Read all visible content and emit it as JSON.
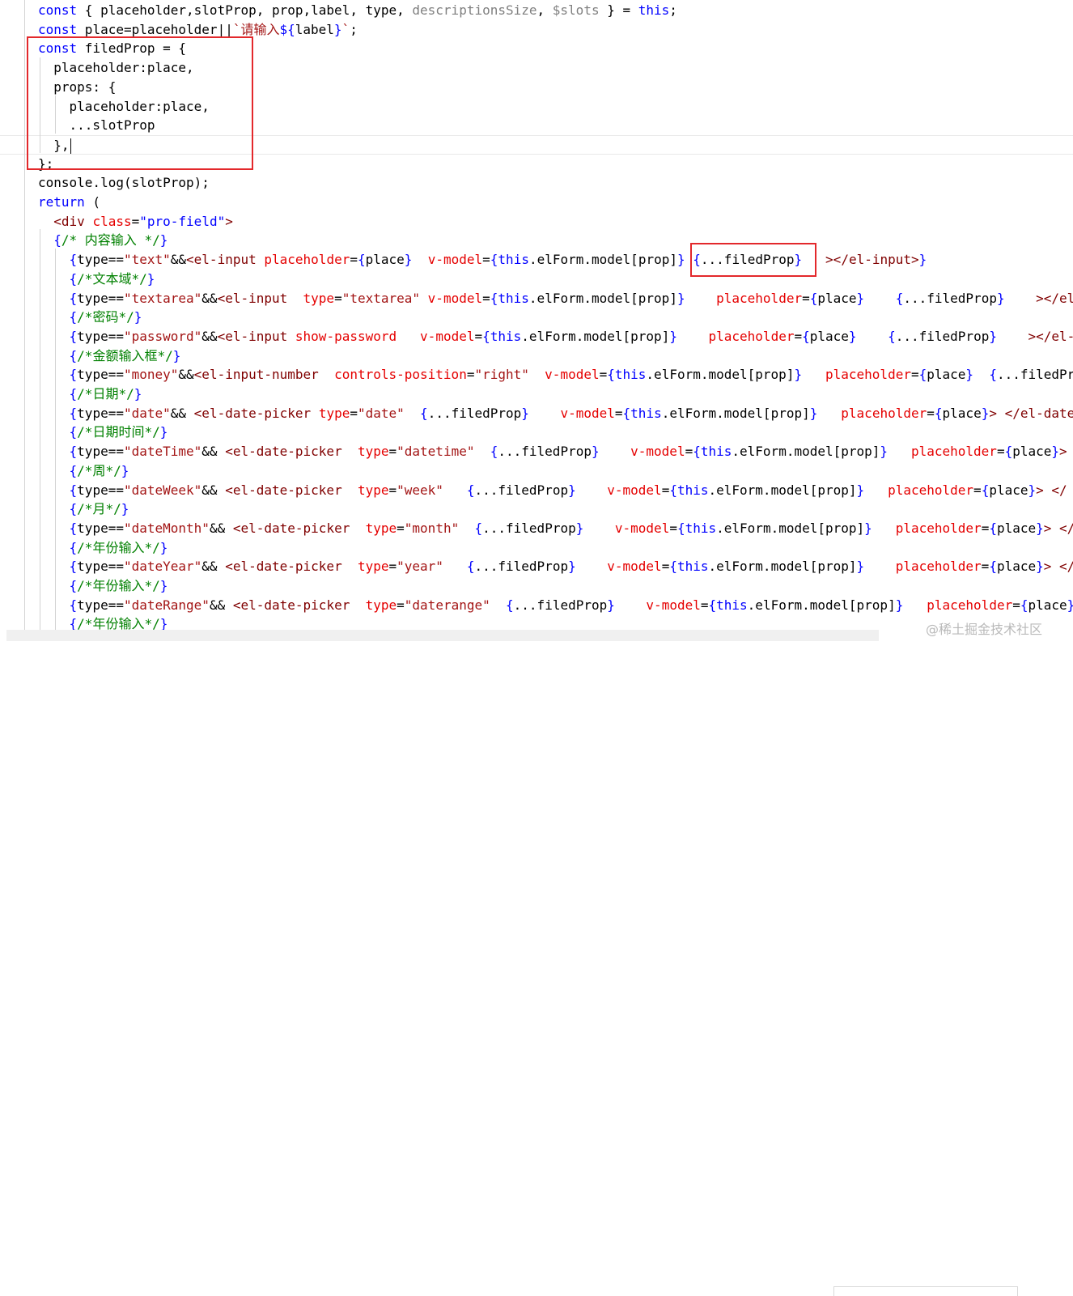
{
  "colors": {
    "keyword": "#0000ff",
    "string": "#a31515",
    "attribute": "#e50000",
    "tag": "#800000",
    "comment": "#008000",
    "muted": "#7f7f7f",
    "plain": "#000000",
    "highlight_box": "#e3282b"
  },
  "code_lines": [
    [
      [
        "const",
        "keyword"
      ],
      [
        " { placeholder,slotProp, prop,label, type, ",
        "plain"
      ],
      [
        "descriptionsSize",
        "muted"
      ],
      [
        ", ",
        "plain"
      ],
      [
        "$slots",
        "muted"
      ],
      [
        " } = ",
        "plain"
      ],
      [
        "this",
        "keyword"
      ],
      [
        ";",
        "plain"
      ]
    ],
    [
      [
        "const",
        "keyword"
      ],
      [
        " place=placeholder||",
        "plain"
      ],
      [
        "`请输入",
        "string"
      ],
      [
        "${",
        "keyword"
      ],
      [
        "label",
        "plain"
      ],
      [
        "}",
        "keyword"
      ],
      [
        "`",
        "string"
      ],
      [
        ";",
        "plain"
      ]
    ],
    [
      [
        "const",
        "keyword"
      ],
      [
        " filedProp = {",
        "plain"
      ]
    ],
    [
      [
        "  placeholder:place,",
        "plain"
      ]
    ],
    [
      [
        "  props: {",
        "plain"
      ]
    ],
    [
      [
        "    placeholder:place,",
        "plain"
      ]
    ],
    [
      [
        "    ...slotProp",
        "plain"
      ]
    ],
    [
      [
        "  },",
        "plain"
      ]
    ],
    [
      [
        "};",
        "plain"
      ]
    ],
    [
      [
        "console.log(slotProp);",
        "plain"
      ]
    ],
    [
      [
        "return",
        "keyword"
      ],
      [
        " (",
        "plain"
      ]
    ],
    [
      [
        "  ",
        "plain"
      ],
      [
        "<div",
        "tag"
      ],
      [
        " ",
        "plain"
      ],
      [
        "class",
        "attribute"
      ],
      [
        "=",
        "plain"
      ],
      [
        "\"pro-field\"",
        "keyword"
      ],
      [
        ">",
        "tag"
      ]
    ],
    [
      [
        "  ",
        "plain"
      ],
      [
        "{",
        "keyword"
      ],
      [
        "/* 内容输入 */",
        "comment"
      ],
      [
        "}",
        "keyword"
      ]
    ],
    [
      [
        "    ",
        "plain"
      ],
      [
        "{",
        "keyword"
      ],
      [
        "type==",
        "plain"
      ],
      [
        "\"text\"",
        "string"
      ],
      [
        "&&",
        "plain"
      ],
      [
        "<el-input",
        "tag"
      ],
      [
        " ",
        "plain"
      ],
      [
        "placeholder",
        "attribute"
      ],
      [
        "=",
        "plain"
      ],
      [
        "{",
        "keyword"
      ],
      [
        "place",
        "plain"
      ],
      [
        "}",
        "keyword"
      ],
      [
        "  ",
        "plain"
      ],
      [
        "v-model",
        "attribute"
      ],
      [
        "=",
        "plain"
      ],
      [
        "{",
        "keyword"
      ],
      [
        "this",
        "keyword"
      ],
      [
        ".elForm.model[prop]",
        "plain"
      ],
      [
        "}",
        "keyword"
      ],
      [
        " ",
        "plain"
      ],
      [
        "{",
        "keyword"
      ],
      [
        "...filedProp",
        "plain"
      ],
      [
        "}",
        "keyword"
      ],
      [
        "   ",
        "plain"
      ],
      [
        "></el-input>",
        "tag"
      ],
      [
        "}",
        "keyword"
      ]
    ],
    [
      [
        "    ",
        "plain"
      ],
      [
        "{",
        "keyword"
      ],
      [
        "/*文本域*/",
        "comment"
      ],
      [
        "}",
        "keyword"
      ]
    ],
    [
      [
        "    ",
        "plain"
      ],
      [
        "{",
        "keyword"
      ],
      [
        "type==",
        "plain"
      ],
      [
        "\"textarea\"",
        "string"
      ],
      [
        "&&",
        "plain"
      ],
      [
        "<el-input",
        "tag"
      ],
      [
        "  ",
        "plain"
      ],
      [
        "type",
        "attribute"
      ],
      [
        "=",
        "plain"
      ],
      [
        "\"textarea\"",
        "string"
      ],
      [
        " ",
        "plain"
      ],
      [
        "v-model",
        "attribute"
      ],
      [
        "=",
        "plain"
      ],
      [
        "{",
        "keyword"
      ],
      [
        "this",
        "keyword"
      ],
      [
        ".elForm.model[prop]",
        "plain"
      ],
      [
        "}",
        "keyword"
      ],
      [
        "    ",
        "plain"
      ],
      [
        "placeholder",
        "attribute"
      ],
      [
        "=",
        "plain"
      ],
      [
        "{",
        "keyword"
      ],
      [
        "place",
        "plain"
      ],
      [
        "}",
        "keyword"
      ],
      [
        "    ",
        "plain"
      ],
      [
        "{",
        "keyword"
      ],
      [
        "...filedProp",
        "plain"
      ],
      [
        "}",
        "keyword"
      ],
      [
        "    ",
        "plain"
      ],
      [
        "></el-i",
        "tag"
      ]
    ],
    [
      [
        "    ",
        "plain"
      ],
      [
        "{",
        "keyword"
      ],
      [
        "/*密码*/",
        "comment"
      ],
      [
        "}",
        "keyword"
      ]
    ],
    [
      [
        "    ",
        "plain"
      ],
      [
        "{",
        "keyword"
      ],
      [
        "type==",
        "plain"
      ],
      [
        "\"password\"",
        "string"
      ],
      [
        "&&",
        "plain"
      ],
      [
        "<el-input",
        "tag"
      ],
      [
        " ",
        "plain"
      ],
      [
        "show-password",
        "attribute"
      ],
      [
        "   ",
        "plain"
      ],
      [
        "v-model",
        "attribute"
      ],
      [
        "=",
        "plain"
      ],
      [
        "{",
        "keyword"
      ],
      [
        "this",
        "keyword"
      ],
      [
        ".elForm.model[prop]",
        "plain"
      ],
      [
        "}",
        "keyword"
      ],
      [
        "    ",
        "plain"
      ],
      [
        "placeholder",
        "attribute"
      ],
      [
        "=",
        "plain"
      ],
      [
        "{",
        "keyword"
      ],
      [
        "place",
        "plain"
      ],
      [
        "}",
        "keyword"
      ],
      [
        "    ",
        "plain"
      ],
      [
        "{",
        "keyword"
      ],
      [
        "...filedProp",
        "plain"
      ],
      [
        "}",
        "keyword"
      ],
      [
        "    ",
        "plain"
      ],
      [
        "></el-i",
        "tag"
      ]
    ],
    [
      [
        "    ",
        "plain"
      ],
      [
        "{",
        "keyword"
      ],
      [
        "/*金额输入框*/",
        "comment"
      ],
      [
        "}",
        "keyword"
      ]
    ],
    [
      [
        "    ",
        "plain"
      ],
      [
        "{",
        "keyword"
      ],
      [
        "type==",
        "plain"
      ],
      [
        "\"money\"",
        "string"
      ],
      [
        "&&",
        "plain"
      ],
      [
        "<el-input-number",
        "tag"
      ],
      [
        "  ",
        "plain"
      ],
      [
        "controls-position",
        "attribute"
      ],
      [
        "=",
        "plain"
      ],
      [
        "\"right\"",
        "string"
      ],
      [
        "  ",
        "plain"
      ],
      [
        "v-model",
        "attribute"
      ],
      [
        "=",
        "plain"
      ],
      [
        "{",
        "keyword"
      ],
      [
        "this",
        "keyword"
      ],
      [
        ".elForm.model[prop]",
        "plain"
      ],
      [
        "}",
        "keyword"
      ],
      [
        "   ",
        "plain"
      ],
      [
        "placeholder",
        "attribute"
      ],
      [
        "=",
        "plain"
      ],
      [
        "{",
        "keyword"
      ],
      [
        "place",
        "plain"
      ],
      [
        "}",
        "keyword"
      ],
      [
        "  ",
        "plain"
      ],
      [
        "{",
        "keyword"
      ],
      [
        "...filedPr",
        "plain"
      ]
    ],
    [
      [
        "    ",
        "plain"
      ],
      [
        "{",
        "keyword"
      ],
      [
        "/*日期*/",
        "comment"
      ],
      [
        "}",
        "keyword"
      ]
    ],
    [
      [
        "    ",
        "plain"
      ],
      [
        "{",
        "keyword"
      ],
      [
        "type==",
        "plain"
      ],
      [
        "\"date\"",
        "string"
      ],
      [
        "&& ",
        "plain"
      ],
      [
        "<el-date-picker",
        "tag"
      ],
      [
        " ",
        "plain"
      ],
      [
        "type",
        "attribute"
      ],
      [
        "=",
        "plain"
      ],
      [
        "\"date\"",
        "string"
      ],
      [
        "  ",
        "plain"
      ],
      [
        "{",
        "keyword"
      ],
      [
        "...filedProp",
        "plain"
      ],
      [
        "}",
        "keyword"
      ],
      [
        "    ",
        "plain"
      ],
      [
        "v-model",
        "attribute"
      ],
      [
        "=",
        "plain"
      ],
      [
        "{",
        "keyword"
      ],
      [
        "this",
        "keyword"
      ],
      [
        ".elForm.model[prop]",
        "plain"
      ],
      [
        "}",
        "keyword"
      ],
      [
        "   ",
        "plain"
      ],
      [
        "placeholder",
        "attribute"
      ],
      [
        "=",
        "plain"
      ],
      [
        "{",
        "keyword"
      ],
      [
        "place",
        "plain"
      ],
      [
        "}",
        "keyword"
      ],
      [
        "> </el-date",
        "tag"
      ]
    ],
    [
      [
        "    ",
        "plain"
      ],
      [
        "{",
        "keyword"
      ],
      [
        "/*日期时间*/",
        "comment"
      ],
      [
        "}",
        "keyword"
      ]
    ],
    [
      [
        "    ",
        "plain"
      ],
      [
        "{",
        "keyword"
      ],
      [
        "type==",
        "plain"
      ],
      [
        "\"dateTime\"",
        "string"
      ],
      [
        "&& ",
        "plain"
      ],
      [
        "<el-date-picker",
        "tag"
      ],
      [
        "  ",
        "plain"
      ],
      [
        "type",
        "attribute"
      ],
      [
        "=",
        "plain"
      ],
      [
        "\"datetime\"",
        "string"
      ],
      [
        "  ",
        "plain"
      ],
      [
        "{",
        "keyword"
      ],
      [
        "...filedProp",
        "plain"
      ],
      [
        "}",
        "keyword"
      ],
      [
        "    ",
        "plain"
      ],
      [
        "v-model",
        "attribute"
      ],
      [
        "=",
        "plain"
      ],
      [
        "{",
        "keyword"
      ],
      [
        "this",
        "keyword"
      ],
      [
        ".elForm.model[prop]",
        "plain"
      ],
      [
        "}",
        "keyword"
      ],
      [
        "   ",
        "plain"
      ],
      [
        "placeholder",
        "attribute"
      ],
      [
        "=",
        "plain"
      ],
      [
        "{",
        "keyword"
      ],
      [
        "place",
        "plain"
      ],
      [
        "}",
        "keyword"
      ],
      [
        ">",
        "tag"
      ]
    ],
    [
      [
        "    ",
        "plain"
      ],
      [
        "{",
        "keyword"
      ],
      [
        "/*周*/",
        "comment"
      ],
      [
        "}",
        "keyword"
      ]
    ],
    [
      [
        "    ",
        "plain"
      ],
      [
        "{",
        "keyword"
      ],
      [
        "type==",
        "plain"
      ],
      [
        "\"dateWeek\"",
        "string"
      ],
      [
        "&& ",
        "plain"
      ],
      [
        "<el-date-picker",
        "tag"
      ],
      [
        "  ",
        "plain"
      ],
      [
        "type",
        "attribute"
      ],
      [
        "=",
        "plain"
      ],
      [
        "\"week\"",
        "string"
      ],
      [
        "   ",
        "plain"
      ],
      [
        "{",
        "keyword"
      ],
      [
        "...filedProp",
        "plain"
      ],
      [
        "}",
        "keyword"
      ],
      [
        "    ",
        "plain"
      ],
      [
        "v-model",
        "attribute"
      ],
      [
        "=",
        "plain"
      ],
      [
        "{",
        "keyword"
      ],
      [
        "this",
        "keyword"
      ],
      [
        ".elForm.model[prop]",
        "plain"
      ],
      [
        "}",
        "keyword"
      ],
      [
        "   ",
        "plain"
      ],
      [
        "placeholder",
        "attribute"
      ],
      [
        "=",
        "plain"
      ],
      [
        "{",
        "keyword"
      ],
      [
        "place",
        "plain"
      ],
      [
        "}",
        "keyword"
      ],
      [
        "> </",
        "tag"
      ]
    ],
    [
      [
        "    ",
        "plain"
      ],
      [
        "{",
        "keyword"
      ],
      [
        "/*月*/",
        "comment"
      ],
      [
        "}",
        "keyword"
      ]
    ],
    [
      [
        "    ",
        "plain"
      ],
      [
        "{",
        "keyword"
      ],
      [
        "type==",
        "plain"
      ],
      [
        "\"dateMonth\"",
        "string"
      ],
      [
        "&& ",
        "plain"
      ],
      [
        "<el-date-picker",
        "tag"
      ],
      [
        "  ",
        "plain"
      ],
      [
        "type",
        "attribute"
      ],
      [
        "=",
        "plain"
      ],
      [
        "\"month\"",
        "string"
      ],
      [
        "  ",
        "plain"
      ],
      [
        "{",
        "keyword"
      ],
      [
        "...filedProp",
        "plain"
      ],
      [
        "}",
        "keyword"
      ],
      [
        "    ",
        "plain"
      ],
      [
        "v-model",
        "attribute"
      ],
      [
        "=",
        "plain"
      ],
      [
        "{",
        "keyword"
      ],
      [
        "this",
        "keyword"
      ],
      [
        ".elForm.model[prop]",
        "plain"
      ],
      [
        "}",
        "keyword"
      ],
      [
        "   ",
        "plain"
      ],
      [
        "placeholder",
        "attribute"
      ],
      [
        "=",
        "plain"
      ],
      [
        "{",
        "keyword"
      ],
      [
        "place",
        "plain"
      ],
      [
        "}",
        "keyword"
      ],
      [
        "> </",
        "tag"
      ]
    ],
    [
      [
        "    ",
        "plain"
      ],
      [
        "{",
        "keyword"
      ],
      [
        "/*年份输入*/",
        "comment"
      ],
      [
        "}",
        "keyword"
      ]
    ],
    [
      [
        "    ",
        "plain"
      ],
      [
        "{",
        "keyword"
      ],
      [
        "type==",
        "plain"
      ],
      [
        "\"dateYear\"",
        "string"
      ],
      [
        "&& ",
        "plain"
      ],
      [
        "<el-date-picker",
        "tag"
      ],
      [
        "  ",
        "plain"
      ],
      [
        "type",
        "attribute"
      ],
      [
        "=",
        "plain"
      ],
      [
        "\"year\"",
        "string"
      ],
      [
        "   ",
        "plain"
      ],
      [
        "{",
        "keyword"
      ],
      [
        "...filedProp",
        "plain"
      ],
      [
        "}",
        "keyword"
      ],
      [
        "    ",
        "plain"
      ],
      [
        "v-model",
        "attribute"
      ],
      [
        "=",
        "plain"
      ],
      [
        "{",
        "keyword"
      ],
      [
        "this",
        "keyword"
      ],
      [
        ".elForm.model[prop]",
        "plain"
      ],
      [
        "}",
        "keyword"
      ],
      [
        "    ",
        "plain"
      ],
      [
        "placeholder",
        "attribute"
      ],
      [
        "=",
        "plain"
      ],
      [
        "{",
        "keyword"
      ],
      [
        "place",
        "plain"
      ],
      [
        "}",
        "keyword"
      ],
      [
        "> </",
        "tag"
      ]
    ],
    [
      [
        "    ",
        "plain"
      ],
      [
        "{",
        "keyword"
      ],
      [
        "/*年份输入*/",
        "comment"
      ],
      [
        "}",
        "keyword"
      ]
    ],
    [
      [
        "    ",
        "plain"
      ],
      [
        "{",
        "keyword"
      ],
      [
        "type==",
        "plain"
      ],
      [
        "\"dateRange\"",
        "string"
      ],
      [
        "&& ",
        "plain"
      ],
      [
        "<el-date-picker",
        "tag"
      ],
      [
        "  ",
        "plain"
      ],
      [
        "type",
        "attribute"
      ],
      [
        "=",
        "plain"
      ],
      [
        "\"daterange\"",
        "string"
      ],
      [
        "  ",
        "plain"
      ],
      [
        "{",
        "keyword"
      ],
      [
        "...filedProp",
        "plain"
      ],
      [
        "}",
        "keyword"
      ],
      [
        "    ",
        "plain"
      ],
      [
        "v-model",
        "attribute"
      ],
      [
        "=",
        "plain"
      ],
      [
        "{",
        "keyword"
      ],
      [
        "this",
        "keyword"
      ],
      [
        ".elForm.model[prop]",
        "plain"
      ],
      [
        "}",
        "keyword"
      ],
      [
        "   ",
        "plain"
      ],
      [
        "placeholder",
        "attribute"
      ],
      [
        "=",
        "plain"
      ],
      [
        "{",
        "keyword"
      ],
      [
        "place",
        "plain"
      ],
      [
        "}",
        "keyword"
      ]
    ],
    [
      [
        "    ",
        "plain"
      ],
      [
        "{",
        "keyword"
      ],
      [
        "/*年份输入*/",
        "comment"
      ],
      [
        "}",
        "keyword"
      ]
    ]
  ],
  "cursor_line": 8,
  "watermark": "@稀土掘金技术社区"
}
